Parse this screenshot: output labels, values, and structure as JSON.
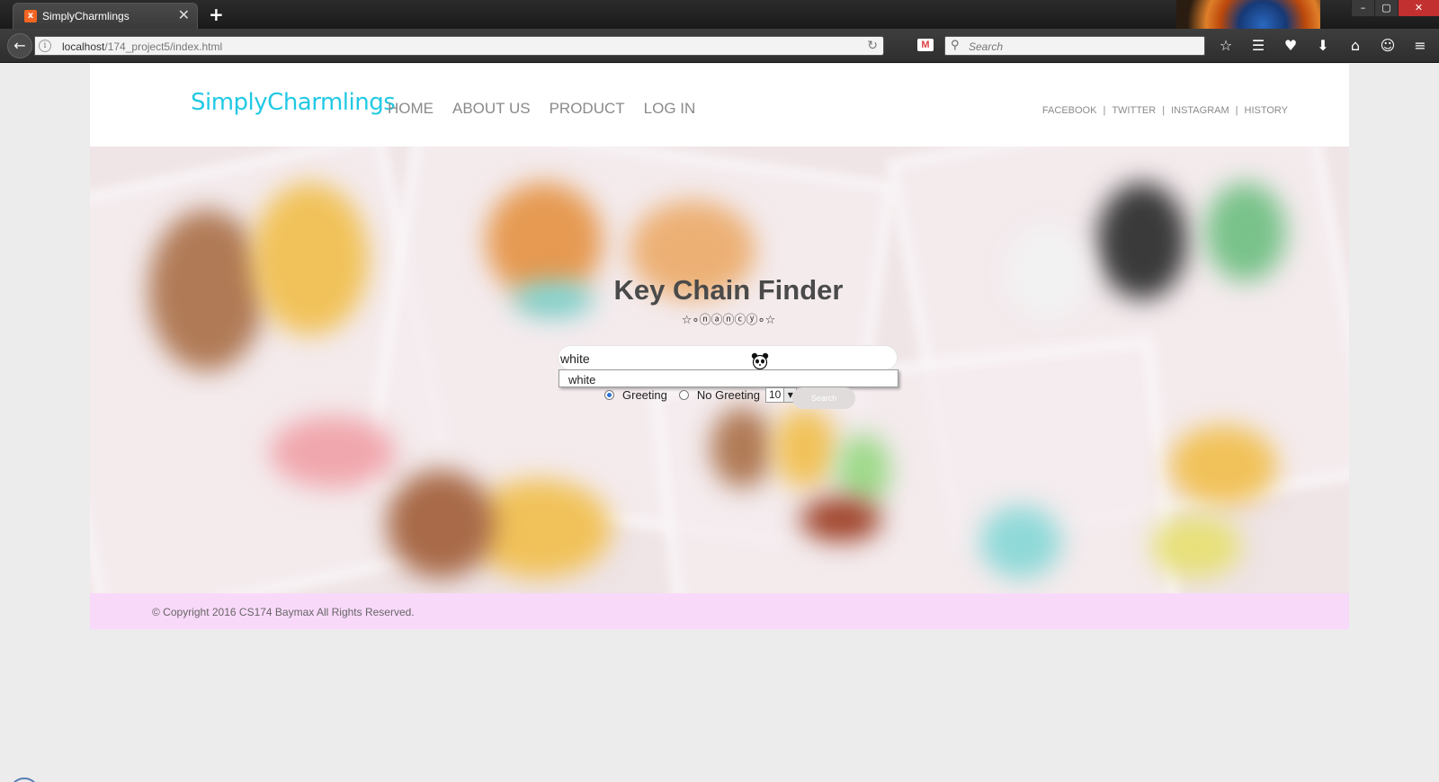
{
  "browser": {
    "tab_title": "SimplyCharmlings",
    "tab_close": "✕",
    "new_tab": "+",
    "url_host": "localhost",
    "url_path": "/174_project5/index.html",
    "search_placeholder": "Search",
    "window_controls": [
      "–",
      "▢",
      "✕"
    ]
  },
  "site": {
    "logo": "SimplyCharmlings",
    "nav": [
      "HOME",
      "ABOUT US",
      "PRODUCT",
      "LOG IN"
    ],
    "social": [
      "FACEBOOK",
      "TWITTER",
      "INSTAGRAM",
      "HISTORY"
    ]
  },
  "finder": {
    "title": "Key Chain Finder",
    "decoration": "☆∘ⓝⓐⓝⓒⓨ∘☆",
    "search_value": "white",
    "autocomplete": [
      "white"
    ],
    "options": {
      "greeting": "Greeting",
      "no_greeting": "No Greeting",
      "selected": "greeting",
      "count": "10"
    },
    "button": "Search"
  },
  "footer": {
    "copyright": "© Copyright 2016 CS174 Baymax All Rights Reserved."
  },
  "colors": {
    "logo": "#22c9e4",
    "footer_bg": "#f9d9fa",
    "header_bg": "#ffffff",
    "page_bg": "#ececec"
  }
}
